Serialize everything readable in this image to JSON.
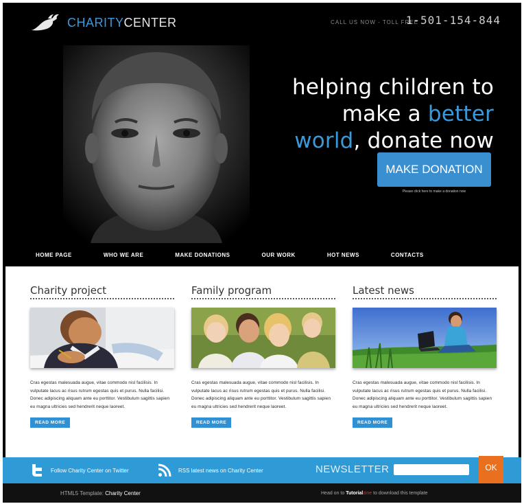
{
  "brand": {
    "name_part1": "CHARITY",
    "name_part2": "CENTER",
    "call_label": "CALL US NOW - TOLL FREE",
    "phone": "1-501-154-844"
  },
  "hero": {
    "line1": "helping children to",
    "line2a": "make a ",
    "line2b": "better",
    "line3a": "world",
    "line3b": ", donate now",
    "button_label": "MAKE DONATION",
    "button_hint": "Please click here to make a donation now"
  },
  "nav": {
    "items": [
      {
        "label": "HOME PAGE"
      },
      {
        "label": "WHO WE ARE"
      },
      {
        "label": "MAKE DONATIONS"
      },
      {
        "label": "OUR WORK"
      },
      {
        "label": "HOT NEWS"
      },
      {
        "label": "CONTACTS"
      }
    ]
  },
  "columns": [
    {
      "title": "Charity project",
      "text": "Cras egestas malesuada augue, vitae commodo nisl facilisis. In vulputate lacus ac risus rutrum egestas quis et purus. Nulla facilisi. Donec adipiscing aliquam ante eu porttitor. Vestibulum sagittis sapien eu magna ultricies sed hendrerit neque laoreet.",
      "button": "READ MORE"
    },
    {
      "title": "Family program",
      "text": "Cras egestas malesuada augue, vitae commodo nisl facilisis. In vulputate lacus ac risus rutrum egestas quis et purus. Nulla facilisi. Donec adipiscing aliquam ante eu porttitor. Vestibulum sagittis sapien eu magna ultricies sed hendrerit neque laoreet.",
      "button": "READ MORE"
    },
    {
      "title": "Latest news",
      "text": "Cras egestas malesuada augue, vitae commodo nisl facilisis. In vulputate lacus ac risus rutrum egestas quis et purus. Nulla facilisi. Donec adipiscing aliquam ante eu porttitor. Vestibulum sagittis sapien eu magna ultricies sed hendrerit neque laoreet.",
      "button": "READ MORE"
    }
  ],
  "footer_bar": {
    "twitter": "Follow Charity Center on Twitter",
    "rss": "RSS latest news on Charity Center",
    "newsletter_label": "NEWSLETTER",
    "ok_label": "OK"
  },
  "bottom": {
    "left_prefix": "HTML5 Template: ",
    "left_name": "Charity Center",
    "right_prefix": "Head on to ",
    "right_brand_a": "Tutorial",
    "right_brand_b": "zine",
    "right_suffix": " to download this template"
  },
  "colors": {
    "accent": "#3a9ad9",
    "bar": "#2e9bd6",
    "ok": "#e8701e"
  }
}
